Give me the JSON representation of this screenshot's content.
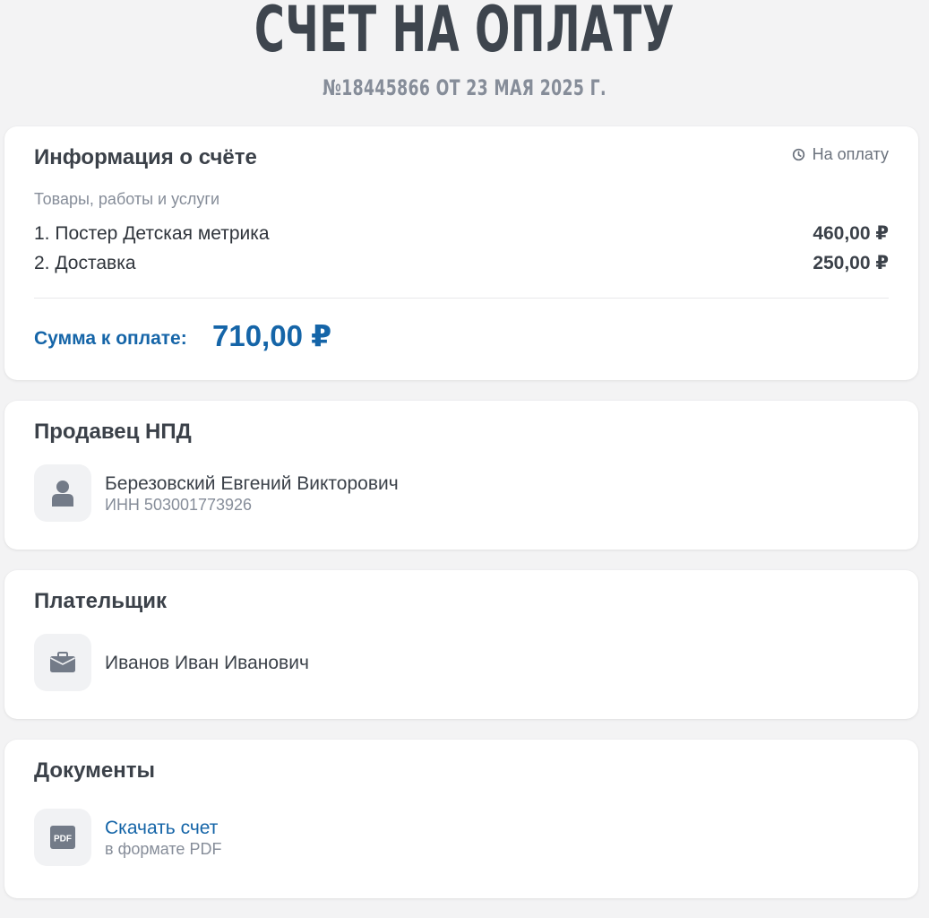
{
  "header": {
    "title": "СЧЕТ НА ОПЛАТУ",
    "subtitle": "№18445866 ОТ 23 МАЯ 2025 Г."
  },
  "invoice": {
    "title": "Информация о счёте",
    "status": "На оплату",
    "status_icon": "clock-icon",
    "items_label": "Товары, работы и услуги",
    "items": [
      {
        "name": "1. Постер Детская метрика",
        "price": "460,00 ₽"
      },
      {
        "name": "2. Доставка",
        "price": "250,00 ₽"
      }
    ],
    "total_label": "Сумма к оплате:",
    "total_value": "710,00 ₽",
    "accent_color": "#1565a8"
  },
  "seller": {
    "title": "Продавец НПД",
    "icon": "person-icon",
    "name": "Березовский Евгений Викторович",
    "inn": "ИНН 503001773926"
  },
  "payer": {
    "title": "Плательщик",
    "icon": "briefcase-icon",
    "name": "Иванов Иван Иванович"
  },
  "documents": {
    "title": "Документы",
    "icon": "pdf-icon",
    "icon_text": "PDF",
    "link_label": "Скачать счет",
    "link_sub": "в формате PDF"
  }
}
